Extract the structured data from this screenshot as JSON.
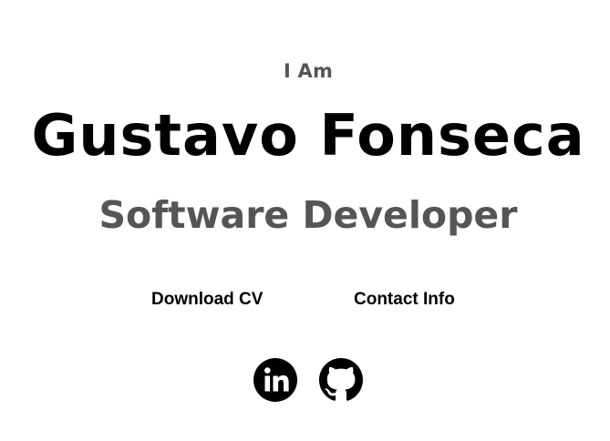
{
  "hero": {
    "greeting": "I Am",
    "name": "Gustavo Fonseca",
    "title": "Software Developer"
  },
  "buttons": {
    "download_cv": "Download CV",
    "contact_info": "Contact Info"
  },
  "social": {
    "icons": [
      "linkedin-icon",
      "github-icon"
    ],
    "icon_color": "#000000"
  },
  "colors": {
    "text_primary": "#000000",
    "text_muted": "#555555",
    "background": "#ffffff"
  }
}
